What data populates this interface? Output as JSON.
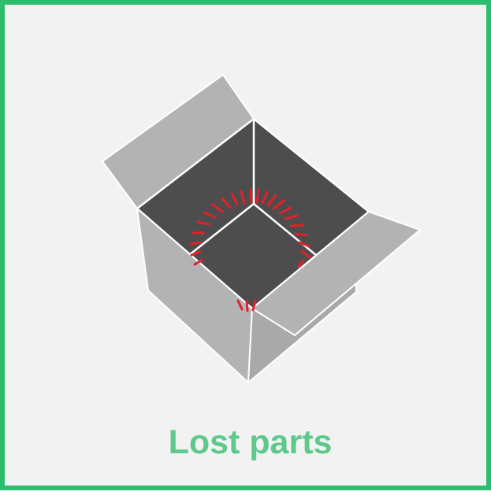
{
  "caption": "Lost parts",
  "icon": {
    "name": "open-box-icon",
    "border_color": "#2dbd6e",
    "background_color": "#f2f2f2",
    "caption_color": "#5dc98a",
    "box_light": "#b3b3b3",
    "box_mid": "#a9a9a9",
    "box_interior": "#4d4d4d",
    "glow_color": "#e3202b"
  }
}
